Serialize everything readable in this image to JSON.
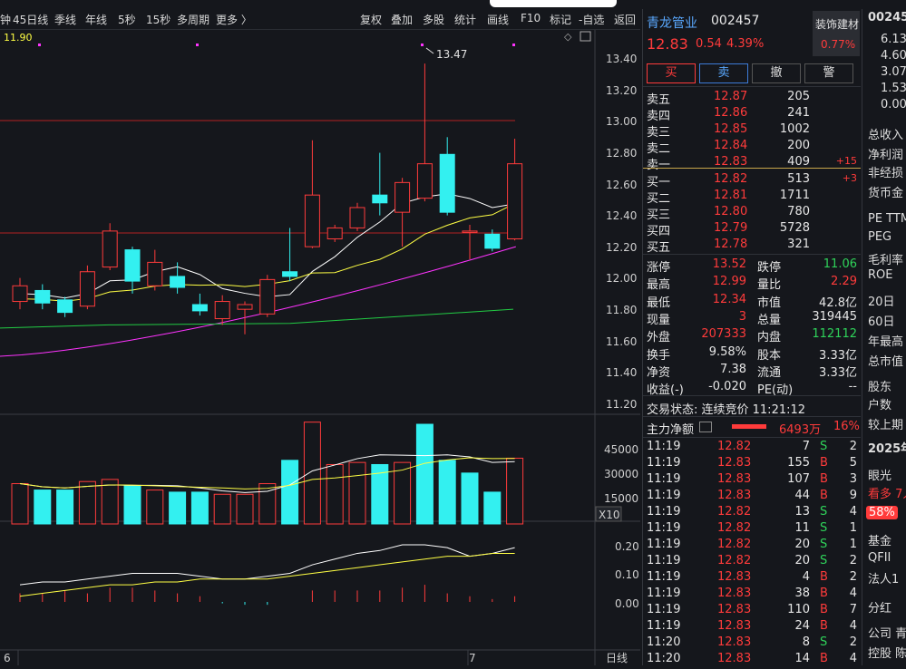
{
  "toolbar": {
    "left": [
      "钟",
      "45日线",
      "季线",
      "年线",
      "5秒",
      "15秒",
      "多周期",
      "更多 〉"
    ],
    "right": [
      "复权",
      "叠加",
      "多股",
      "统计",
      "画线",
      "F10",
      "标记",
      "-自选",
      "返回"
    ]
  },
  "ma_label": "11.90",
  "price_axis": [
    "13.40",
    "13.20",
    "13.00",
    "12.80",
    "12.60",
    "12.40",
    "12.20",
    "12.00",
    "11.80",
    "11.60",
    "11.40",
    "11.20"
  ],
  "high_marker": "13.47",
  "vol_axis": [
    "45000",
    "30000",
    "15000"
  ],
  "vol_unit": "X10",
  "macd_axis": [
    "0.20",
    "0.10",
    "0.00"
  ],
  "date_labels": [
    "6",
    "7"
  ],
  "period_btn": "日线",
  "colors": {
    "up": "#ff3b3b",
    "down": "#33f0f0",
    "bg": "#15171c",
    "grid": "#b22222",
    "ma5": "#ffffff",
    "ma10": "#ffff44",
    "ma20": "#ff33ff",
    "ma60": "#22cc44"
  },
  "chart_data": {
    "type": "candlestick",
    "ylim": [
      11.2,
      13.5
    ],
    "candles": [
      {
        "o": 11.95,
        "c": 12.05,
        "h": 12.1,
        "l": 11.9
      },
      {
        "o": 12.02,
        "c": 11.94,
        "h": 12.06,
        "l": 11.9
      },
      {
        "o": 11.96,
        "c": 11.88,
        "h": 11.98,
        "l": 11.85
      },
      {
        "o": 11.92,
        "c": 12.14,
        "h": 12.18,
        "l": 11.9
      },
      {
        "o": 12.17,
        "c": 12.4,
        "h": 12.45,
        "l": 12.15
      },
      {
        "o": 12.28,
        "c": 12.08,
        "h": 12.3,
        "l": 12.0
      },
      {
        "o": 12.05,
        "c": 12.2,
        "h": 12.28,
        "l": 12.02
      },
      {
        "o": 12.11,
        "c": 12.04,
        "h": 12.2,
        "l": 12.0
      },
      {
        "o": 11.93,
        "c": 11.89,
        "h": 12.0,
        "l": 11.86
      },
      {
        "o": 11.84,
        "c": 11.95,
        "h": 11.99,
        "l": 11.8
      },
      {
        "o": 11.9,
        "c": 11.93,
        "h": 11.95,
        "l": 11.74
      },
      {
        "o": 11.87,
        "c": 12.09,
        "h": 12.12,
        "l": 11.85
      },
      {
        "o": 12.14,
        "c": 12.11,
        "h": 12.42,
        "l": 12.08
      },
      {
        "o": 12.3,
        "c": 12.63,
        "h": 12.98,
        "l": 12.29
      },
      {
        "o": 12.35,
        "c": 12.42,
        "h": 12.44,
        "l": 12.33
      },
      {
        "o": 12.42,
        "c": 12.55,
        "h": 12.58,
        "l": 12.4
      },
      {
        "o": 12.63,
        "c": 12.58,
        "h": 12.9,
        "l": 12.5
      },
      {
        "o": 12.52,
        "c": 12.71,
        "h": 12.74,
        "l": 12.3
      },
      {
        "o": 12.61,
        "c": 12.83,
        "h": 13.47,
        "l": 12.59
      },
      {
        "o": 12.89,
        "c": 12.52,
        "h": 13.0,
        "l": 12.5
      },
      {
        "o": 12.4,
        "c": 12.4,
        "h": 12.44,
        "l": 12.22
      },
      {
        "o": 12.38,
        "c": 12.29,
        "h": 12.41,
        "l": 12.27
      },
      {
        "o": 12.35,
        "c": 12.83,
        "h": 12.99,
        "l": 12.34
      }
    ],
    "volume": [
      {
        "v": 19000,
        "up": true
      },
      {
        "v": 16000,
        "up": false
      },
      {
        "v": 16000,
        "up": false
      },
      {
        "v": 20000,
        "up": true
      },
      {
        "v": 21000,
        "up": true
      },
      {
        "v": 18000,
        "up": false
      },
      {
        "v": 16000,
        "up": true
      },
      {
        "v": 15000,
        "up": false
      },
      {
        "v": 15000,
        "up": false
      },
      {
        "v": 14000,
        "up": true
      },
      {
        "v": 14000,
        "up": true
      },
      {
        "v": 19000,
        "up": true
      },
      {
        "v": 30000,
        "up": false
      },
      {
        "v": 48000,
        "up": true
      },
      {
        "v": 28000,
        "up": true
      },
      {
        "v": 29000,
        "up": true
      },
      {
        "v": 28000,
        "up": false
      },
      {
        "v": 29000,
        "up": true
      },
      {
        "v": 47000,
        "up": false
      },
      {
        "v": 30000,
        "up": false
      },
      {
        "v": 24000,
        "up": false
      },
      {
        "v": 15000,
        "up": false
      },
      {
        "v": 31000,
        "up": true
      }
    ],
    "macd": [
      0.03,
      0.03,
      0.04,
      0.03,
      0.05,
      0.05,
      0.04,
      0.03,
      0.02,
      -0.005,
      -0.01,
      -0.01,
      0.0,
      0.04,
      0.04,
      0.04,
      0.04,
      0.05,
      0.06,
      0.03,
      0.02,
      0.01,
      0.02
    ]
  },
  "stock": {
    "name": "青龙管业",
    "code": "002457",
    "price": "12.83",
    "change": "0.54",
    "pct": "4.39%",
    "sector": "装饰建材",
    "sector_pct": "0.77%"
  },
  "trade_buttons": [
    "买",
    "卖",
    "撤",
    "警"
  ],
  "asks": [
    {
      "label": "卖五",
      "price": "12.87",
      "vol": "205",
      "delta": ""
    },
    {
      "label": "卖四",
      "price": "12.86",
      "vol": "241",
      "delta": ""
    },
    {
      "label": "卖三",
      "price": "12.85",
      "vol": "1002",
      "delta": ""
    },
    {
      "label": "卖二",
      "price": "12.84",
      "vol": "200",
      "delta": ""
    },
    {
      "label": "卖一",
      "price": "12.83",
      "vol": "409",
      "delta": "+15"
    }
  ],
  "bids": [
    {
      "label": "买一",
      "price": "12.82",
      "vol": "513",
      "delta": "+3"
    },
    {
      "label": "买二",
      "price": "12.81",
      "vol": "1711",
      "delta": ""
    },
    {
      "label": "买三",
      "price": "12.80",
      "vol": "780",
      "delta": ""
    },
    {
      "label": "买四",
      "price": "12.79",
      "vol": "5728",
      "delta": ""
    },
    {
      "label": "买五",
      "price": "12.78",
      "vol": "321",
      "delta": ""
    }
  ],
  "stats": [
    {
      "l1": "涨停",
      "v1": "13.52",
      "c1": "red",
      "l2": "跌停",
      "v2": "11.06",
      "c2": "green"
    },
    {
      "l1": "最高",
      "v1": "12.99",
      "c1": "red",
      "l2": "量比",
      "v2": "2.29",
      "c2": "red"
    },
    {
      "l1": "最低",
      "v1": "12.34",
      "c1": "red",
      "l2": "市值",
      "v2": "42.8亿",
      "c2": "white"
    },
    {
      "l1": "现量",
      "v1": "3",
      "c1": "red",
      "l2": "总量",
      "v2": "319445",
      "c2": "white"
    },
    {
      "l1": "外盘",
      "v1": "207333",
      "c1": "red",
      "l2": "内盘",
      "v2": "112112",
      "c2": "green"
    },
    {
      "l1": "换手",
      "v1": "9.58%",
      "c1": "white",
      "l2": "股本",
      "v2": "3.33亿",
      "c2": "white"
    },
    {
      "l1": "净资",
      "v1": "7.38",
      "c1": "white",
      "l2": "流通",
      "v2": "3.33亿",
      "c2": "white"
    },
    {
      "l1": "收益(-)",
      "v1": "-0.020",
      "c1": "white",
      "l2": "PE(动)",
      "v2": "--",
      "c2": "white"
    }
  ],
  "trade_status": "交易状态: 连续竞价 11:21:12",
  "main_flow": {
    "label": "主力净额",
    "amount": "6493万",
    "pct": "16%"
  },
  "ticks": [
    {
      "t": "11:19",
      "p": "12.82",
      "v": "7",
      "s": "S",
      "n": "2"
    },
    {
      "t": "11:19",
      "p": "12.83",
      "v": "155",
      "s": "B",
      "n": "5"
    },
    {
      "t": "11:19",
      "p": "12.83",
      "v": "107",
      "s": "B",
      "n": "3"
    },
    {
      "t": "11:19",
      "p": "12.83",
      "v": "44",
      "s": "B",
      "n": "9"
    },
    {
      "t": "11:19",
      "p": "12.82",
      "v": "13",
      "s": "S",
      "n": "4"
    },
    {
      "t": "11:19",
      "p": "12.82",
      "v": "11",
      "s": "S",
      "n": "1"
    },
    {
      "t": "11:19",
      "p": "12.82",
      "v": "20",
      "s": "S",
      "n": "1"
    },
    {
      "t": "11:19",
      "p": "12.82",
      "v": "20",
      "s": "S",
      "n": "2"
    },
    {
      "t": "11:19",
      "p": "12.83",
      "v": "4",
      "s": "B",
      "n": "2"
    },
    {
      "t": "11:19",
      "p": "12.83",
      "v": "38",
      "s": "B",
      "n": "4"
    },
    {
      "t": "11:19",
      "p": "12.83",
      "v": "110",
      "s": "B",
      "n": "7"
    },
    {
      "t": "11:19",
      "p": "12.83",
      "v": "24",
      "s": "B",
      "n": "4"
    },
    {
      "t": "11:20",
      "p": "12.83",
      "v": "8",
      "s": "S",
      "n": "2"
    },
    {
      "t": "11:20",
      "p": "12.83",
      "v": "14",
      "s": "B",
      "n": "4"
    }
  ],
  "far_panel": [
    "00245",
    "6.13",
    "4.60",
    "3.07",
    "1.53",
    "0.00",
    "总收入",
    "净利润",
    "非经损",
    "货币金",
    "PE TTM",
    "PEG",
    "毛利率",
    "ROE",
    "20日",
    "60日",
    "年最高",
    "总市值",
    "股东",
    "户数",
    "较上期",
    "2025年",
    "眼光",
    "看多 7人",
    "58%",
    "基金",
    "QFII",
    "法人1",
    "分红",
    "公司 青",
    "控股 陈"
  ]
}
